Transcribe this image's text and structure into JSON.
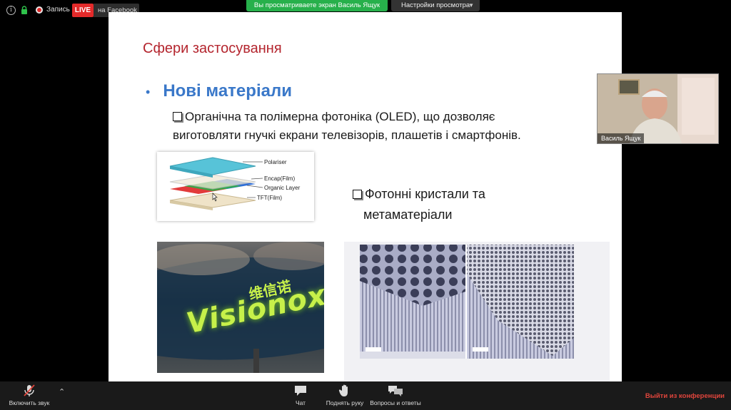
{
  "topbar": {
    "recording_label": "Запись",
    "live_badge": "LIVE",
    "live_destination": "на Facebook",
    "share_banner": "Вы просматриваете экран Василь Ящук",
    "view_settings": "Настройки просмотра"
  },
  "slide": {
    "title": "Сфери застосування",
    "bullet": "Нові матеріали",
    "sub_line1": "Органічна та полімерна фотоніка (OLED), що дозволяє",
    "sub_line2": "виготовляти гнучкі екрани телевізорів, плашетів і смартфонів.",
    "sub2_line1": "Фотонні кристали та",
    "sub2_line2": "метаматеріали",
    "oled_layers": [
      "Polariser",
      "Encap(Film)",
      "Organic Layer",
      "TFT(Film)"
    ],
    "visionox_text": "Visionox",
    "visionox_chinese": "维信诺"
  },
  "participant": {
    "name": "Василь Ящук"
  },
  "toolbar": {
    "unmute": "Включить звук",
    "chat": "Чат",
    "raise_hand": "Поднять руку",
    "qa": "Вопросы и ответы",
    "leave": "Выйти из конференции"
  },
  "colors": {
    "live": "#e32a2a",
    "share_banner": "#27b04b",
    "slide_title": "#b4252e",
    "bullet": "#3a78c9",
    "leave": "#e0453c"
  }
}
